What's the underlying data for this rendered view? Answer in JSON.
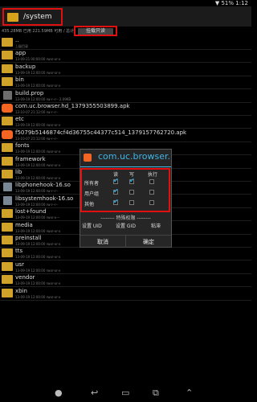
{
  "status": {
    "battery": "51%",
    "time": "1:12"
  },
  "header": {
    "path": "/system"
  },
  "info": {
    "storage": "435.28MB 已用 221.59MB 可用 / 总计",
    "mount_label": "挂载只读"
  },
  "files": [
    {
      "name": "..",
      "meta": "上级目录",
      "type": "folder"
    },
    {
      "name": "app",
      "meta": "13-09-21 00:00:00  rwxr-xr-x",
      "type": "folder"
    },
    {
      "name": "backup",
      "meta": "13-09-19 12:00:00  rwxr-xr-x",
      "type": "folder"
    },
    {
      "name": "bin",
      "meta": "13-09-19 12:00:00  rwxr-xr-x",
      "type": "folder"
    },
    {
      "name": "build.prop",
      "meta": "13-09-19 12:00:00  rw-r--r--  2.09KB",
      "type": "file"
    },
    {
      "name": "com.uc.browser.hd_1379355503899.apk",
      "meta": "13-10-07 21:12:00  rw-r--r--",
      "type": "apk"
    },
    {
      "name": "etc",
      "meta": "13-09-19 12:00:00  rwxr-xr-x",
      "type": "folder"
    },
    {
      "name": "f5079b5146874cf4d36755c44377c514_1379157762720.apk",
      "meta": "13-10-07 21:12:00  rw-r--r--",
      "type": "apk2"
    },
    {
      "name": "fonts",
      "meta": "13-09-19 12:00:00  rwxr-xr-x",
      "type": "folder"
    },
    {
      "name": "framework",
      "meta": "13-09-19 12:00:00  rwxr-xr-x",
      "type": "folder"
    },
    {
      "name": "lib",
      "meta": "13-09-19 12:00:00  rwxr-xr-x",
      "type": "folder"
    },
    {
      "name": "libphonehook-16.so",
      "meta": "13-09-19 12:00:00  rw-r--r--",
      "type": "so"
    },
    {
      "name": "libsystemhook-16.so",
      "meta": "13-09-19 12:00:00  rw-r--r--",
      "type": "so"
    },
    {
      "name": "lost+found",
      "meta": "13-09-19 12:00:00  rwxr-x---",
      "type": "folder"
    },
    {
      "name": "media",
      "meta": "13-09-19 12:00:00  rwxr-xr-x",
      "type": "folder"
    },
    {
      "name": "preinstall",
      "meta": "13-09-19 12:00:00  rwxr-xr-x",
      "type": "folder"
    },
    {
      "name": "tts",
      "meta": "13-09-19 12:00:00  rwxr-xr-x",
      "type": "folder"
    },
    {
      "name": "usr",
      "meta": "13-09-19 12:00:00  rwxr-xr-x",
      "type": "folder"
    },
    {
      "name": "vendor",
      "meta": "13-09-19 12:00:00  rwxr-xr-x",
      "type": "folder"
    },
    {
      "name": "xbin",
      "meta": "13-09-19 12:00:00  rwxr-xr-x",
      "type": "folder"
    }
  ],
  "dialog": {
    "title": "com.uc.browser.",
    "columns": [
      "读",
      "写",
      "执行"
    ],
    "rows": [
      {
        "label": "所有者",
        "read": true,
        "write": true,
        "exec": false
      },
      {
        "label": "用户组",
        "read": true,
        "write": false,
        "exec": false
      },
      {
        "label": "其他",
        "read": true,
        "write": false,
        "exec": false
      }
    ],
    "special_label": "-------- 特殊权限 --------",
    "setuid": "设置 UID",
    "setgid": "设置 GID",
    "sticky": "粘滞",
    "cancel": "取消",
    "ok": "确定"
  },
  "nav": {
    "home_icon": "home-icon",
    "back_icon": "back-icon",
    "recent_icon": "recent-icon",
    "up_icon": "up-icon"
  }
}
